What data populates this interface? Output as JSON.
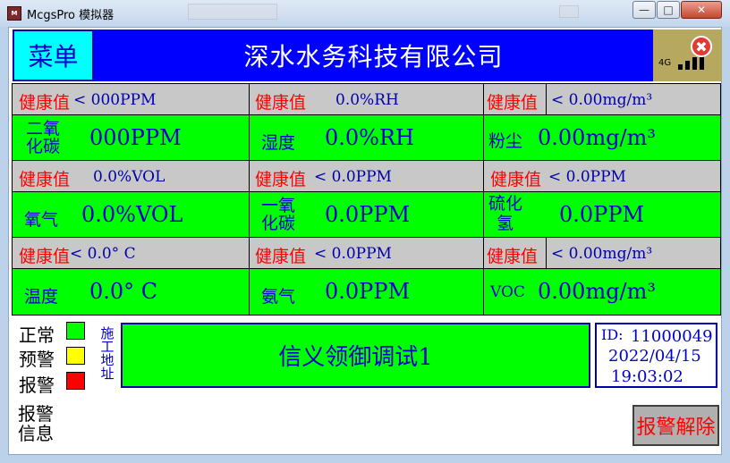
{
  "window": {
    "title": "McgsPro 模拟器",
    "icon_text": "M",
    "min_label": "—",
    "max_label": "□",
    "close_label": "✕"
  },
  "header": {
    "menu_label": "菜单",
    "company": "深水水务科技有限公司",
    "network": "4G",
    "close_icon": "✖"
  },
  "grid": {
    "rows": [
      {
        "health": [
          {
            "label": "健康值",
            "value": "< 000PPM"
          },
          {
            "label": "健康值",
            "value": "0.0%RH"
          },
          {
            "label": "健康值",
            "value": "<  0.00mg/m³"
          }
        ],
        "readings": [
          {
            "label_line1": "二氧",
            "label_line2": "化碳",
            "value": "000PPM"
          },
          {
            "label": "湿度",
            "value": "0.0%RH"
          },
          {
            "label": "粉尘",
            "value": "0.00mg/m³"
          }
        ]
      },
      {
        "health": [
          {
            "label": "健康值",
            "value": "0.0%VOL"
          },
          {
            "label": "健康值",
            "value": "< 0.0PPM"
          },
          {
            "label": "健康值",
            "value": "< 0.0PPM"
          }
        ],
        "readings": [
          {
            "label": "氧气",
            "value": "0.0%VOL"
          },
          {
            "label_line1": "一氧",
            "label_line2": "化碳",
            "value": "0.0PPM"
          },
          {
            "label_line1": "硫化",
            "label_line2": "氢",
            "value": "0.0PPM"
          }
        ]
      },
      {
        "health": [
          {
            "label": "健康值",
            "value": "<  0.0° C"
          },
          {
            "label": "健康值",
            "value": "< 0.0PPM"
          },
          {
            "label": "健康值",
            "value": "<  0.00mg/m³"
          }
        ],
        "readings": [
          {
            "label": "温度",
            "value": "0.0° C"
          },
          {
            "label": "氨气",
            "value": "0.0PPM"
          },
          {
            "label": "VOC",
            "value": "0.00mg/m³"
          }
        ]
      }
    ]
  },
  "legend": [
    {
      "label": "正常",
      "color": "#00ff00"
    },
    {
      "label": "预警",
      "color": "#ffff00"
    },
    {
      "label": "报警",
      "color": "#ff0000"
    }
  ],
  "site": {
    "label": "施工地址",
    "label_chars": [
      "施",
      "工",
      "地",
      "址"
    ],
    "name": "信义领御调试1"
  },
  "device": {
    "id_label": "ID:",
    "id_value": "11000049",
    "date": "2022/04/15",
    "time": "19:03:02"
  },
  "alarm": {
    "info_line1": "报警",
    "info_line2": "信息",
    "reset_label": "报警解除"
  }
}
